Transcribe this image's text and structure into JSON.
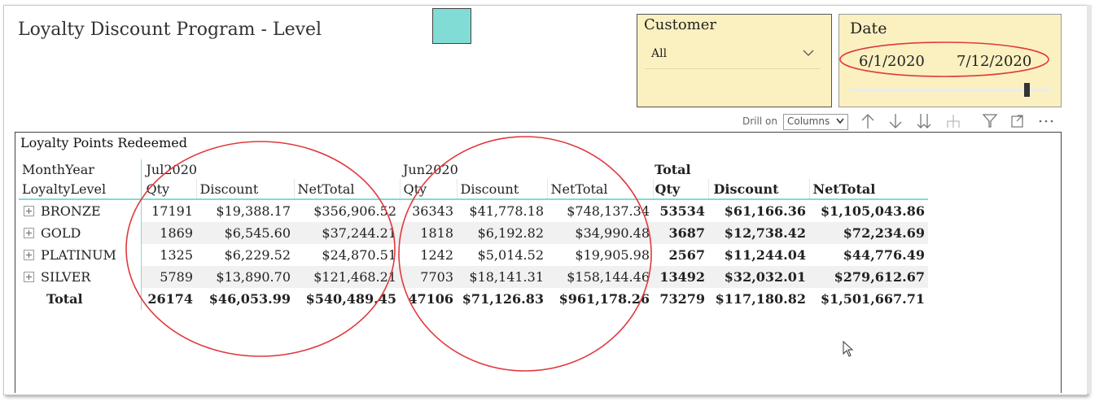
{
  "report": {
    "title": "Loyalty Discount Program - Level",
    "swatch_color": "#80dcd4"
  },
  "customer_slicer": {
    "header": "Customer",
    "selected": "All",
    "icon": "chevron-down-icon"
  },
  "date_slicer": {
    "header": "Date",
    "start": "6/1/2020",
    "end": "7/12/2020"
  },
  "toolbar": {
    "drill_on_label": "Drill on",
    "drill_on_value": "Columns",
    "icons": [
      "drill-up-icon",
      "drill-down-icon",
      "expand-all-icon",
      "expand-hierarchy-icon",
      "filter-icon",
      "focus-mode-icon",
      "more-options-icon"
    ]
  },
  "matrix": {
    "title": "Loyalty Points Redeemed",
    "row_header_1": "MonthYear",
    "row_header_2": "LoyaltyLevel",
    "groups": [
      "Jul2020",
      "Jun2020",
      "Total"
    ],
    "measures": [
      "Qty",
      "Discount",
      "NetTotal"
    ],
    "rows": [
      {
        "level": "BRONZE",
        "jul": [
          "17191",
          "$19,388.17",
          "$356,906.52"
        ],
        "jun": [
          "36343",
          "$41,778.18",
          "$748,137.34"
        ],
        "total": [
          "53534",
          "$61,166.36",
          "$1,105,043.86"
        ]
      },
      {
        "level": "GOLD",
        "jul": [
          "1869",
          "$6,545.60",
          "$37,244.21"
        ],
        "jun": [
          "1818",
          "$6,192.82",
          "$34,990.48"
        ],
        "total": [
          "3687",
          "$12,738.42",
          "$72,234.69"
        ]
      },
      {
        "level": "PLATINUM",
        "jul": [
          "1325",
          "$6,229.52",
          "$24,870.51"
        ],
        "jun": [
          "1242",
          "$5,014.52",
          "$19,905.98"
        ],
        "total": [
          "2567",
          "$11,244.04",
          "$44,776.49"
        ]
      },
      {
        "level": "SILVER",
        "jul": [
          "5789",
          "$13,890.70",
          "$121,468.21"
        ],
        "jun": [
          "7703",
          "$18,141.31",
          "$158,144.46"
        ],
        "total": [
          "13492",
          "$32,032.01",
          "$279,612.67"
        ]
      }
    ],
    "total_row": {
      "label": "Total",
      "jul": [
        "26174",
        "$46,053.99",
        "$540,489.45"
      ],
      "jun": [
        "47106",
        "$71,126.83",
        "$961,178.26"
      ],
      "total": [
        "73279",
        "$117,180.82",
        "$1,501,667.71"
      ]
    }
  },
  "annotations": {
    "circle_color": "#e0393e"
  }
}
